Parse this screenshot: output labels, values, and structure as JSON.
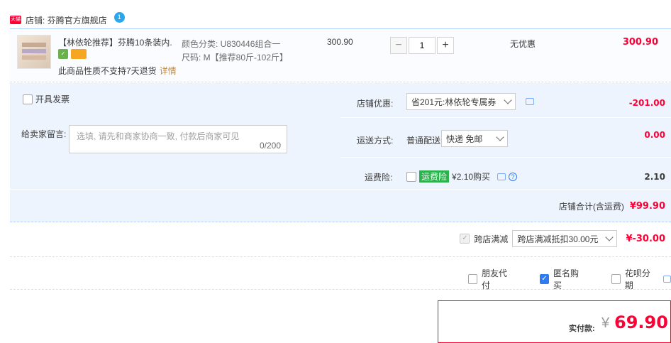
{
  "shop": {
    "logo_text": "天猫",
    "label": "店铺: 芬腾官方旗舰店",
    "badge": "1"
  },
  "item": {
    "title": "【林依轮推荐】芬腾10条装内...",
    "badge_green": "✓",
    "return_note": "此商品性质不支持7天退货",
    "return_more": "详情",
    "sku_color": "颜色分类: U830446组合一",
    "sku_size": "尺码: M【推荐80斤-102斤】",
    "unit_price": "300.90",
    "quantity": "1",
    "qty_minus": "−",
    "qty_plus": "+",
    "discount": "无优惠",
    "subtotal": "300.90"
  },
  "order": {
    "invoice_label": "开具发票",
    "message_label": "给卖家留言:",
    "message_placeholder": "选填, 请先和商家协商一致, 付款后商家可见",
    "message_count": "0/200",
    "shop_discount_label": "店铺优惠:",
    "shop_discount_value": "省201元:林依轮专属券",
    "shop_discount_amount": "-201.00",
    "shipping_label": "运送方式:",
    "shipping_type": "普通配送",
    "shipping_value": "快递 免邮",
    "shipping_amount": "0.00",
    "insurance_label": "运费险:",
    "insurance_tag": "运费险",
    "insurance_price": "¥2.10购买",
    "insurance_amount": "2.10",
    "help_q": "?",
    "shop_total_label": "店铺合计(含运费)",
    "shop_total_amount": "¥99.90"
  },
  "cross_store": {
    "checkbox_mark": "✓",
    "label": "跨店满减",
    "select_value": "跨店满减抵扣30.00元",
    "amount": "¥-30.00"
  },
  "options": {
    "friend_pay": "朋友代付",
    "anonymous": "匿名购买",
    "anonymous_mark": "✓",
    "huabei": "花呗分期"
  },
  "payment": {
    "label": "实付款:",
    "currency": "¥",
    "amount": "69.90"
  },
  "colors": {
    "accent_red": "#ff0036",
    "accent_blue": "#2f7cf0",
    "panel_bg": "#eef4fd"
  }
}
